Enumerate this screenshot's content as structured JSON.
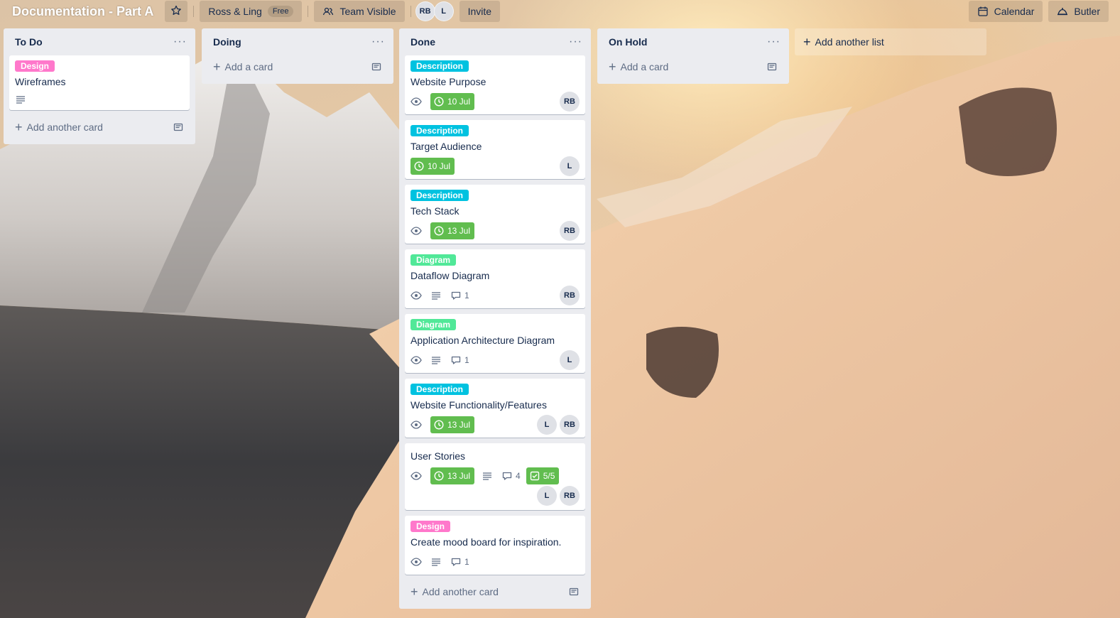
{
  "board": {
    "title": "Documentation - Part A",
    "workspace": "Ross & Ling",
    "plan_badge": "Free",
    "visibility": "Team Visible",
    "members": [
      "RB",
      "L"
    ],
    "invite_label": "Invite",
    "calendar_label": "Calendar",
    "butler_label": "Butler"
  },
  "lists": [
    {
      "title": "To Do",
      "cards": [
        {
          "label": "Design",
          "title": "Wireframes"
        }
      ],
      "add_label": "Add another card"
    },
    {
      "title": "Doing",
      "add_label": "Add a card"
    },
    {
      "title": "Done",
      "cards": [
        {
          "label": "Description",
          "title": "Website Purpose",
          "due": "10 Jul",
          "members": [
            "RB"
          ]
        },
        {
          "label": "Description",
          "title": "Target Audience",
          "due": "10 Jul",
          "members": [
            "L"
          ]
        },
        {
          "label": "Description",
          "title": "Tech Stack",
          "due": "13 Jul",
          "members": [
            "RB"
          ]
        },
        {
          "label": "Diagram",
          "title": "Dataflow Diagram",
          "comments": "1",
          "members": [
            "RB"
          ]
        },
        {
          "label": "Diagram",
          "title": "Application Architecture Diagram",
          "comments": "1",
          "members": [
            "L"
          ]
        },
        {
          "label": "Description",
          "title": "Website Functionality/Features",
          "due": "13 Jul",
          "members": [
            "L",
            "RB"
          ]
        },
        {
          "title": "User Stories",
          "due": "13 Jul",
          "comments": "4",
          "checklist": "5/5",
          "members": [
            "L",
            "RB"
          ]
        },
        {
          "label": "Design",
          "title": "Create mood board for inspiration.",
          "comments": "1"
        }
      ],
      "add_label": "Add another card"
    },
    {
      "title": "On Hold",
      "add_label": "Add a card"
    }
  ],
  "add_list_label": "Add another list",
  "icons": {
    "star": "star-icon",
    "visibility": "team-visible-icon",
    "calendar": "calendar-icon",
    "butler": "butler-icon",
    "watch": "eye-icon",
    "description": "description-icon",
    "comment": "comment-icon",
    "due": "clock-icon",
    "checklist": "checklist-icon",
    "template": "card-template-icon",
    "menu": "ellipsis-icon"
  },
  "colors": {
    "label_design": "#ff78cb",
    "label_description": "#00c2e0",
    "label_diagram": "#51e898",
    "due_complete": "#61bd4f",
    "list_bg": "#ebecf0"
  }
}
